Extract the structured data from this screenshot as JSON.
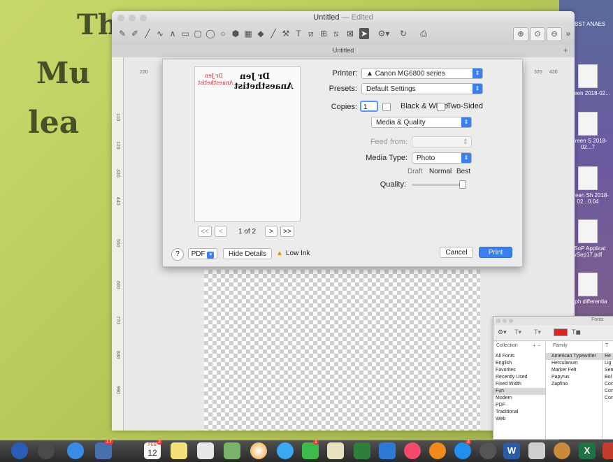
{
  "whiteboard": {
    "line1": "Th",
    "line2": "Mu",
    "line3": "lea"
  },
  "desktop": {
    "files": [
      {
        "label": "OBST ANAES"
      },
      {
        "label": "Screen 2018-02..."
      },
      {
        "label": "Screen S 2018-02...7"
      },
      {
        "label": "Screen Sh 2018-02...0.04"
      },
      {
        "label": "CSoP Applicat vSep17.pdf"
      },
      {
        "label": "pdph differentia"
      }
    ],
    "side_label_1": "n",
    "side_label_2": "m"
  },
  "window": {
    "title": "Untitled",
    "edited": "— Edited",
    "tab_title": "Untitled",
    "ruler_ticks": [
      "220",
      "110",
      "120",
      "330",
      "440",
      "550",
      "660",
      "770",
      "880",
      "990"
    ],
    "ruler_right_1": "320",
    "ruler_right_2": "430",
    "ruler_left_top": "220"
  },
  "print": {
    "printer_label": "Printer:",
    "printer_value": "▲ Canon MG6800 series",
    "presets_label": "Presets:",
    "presets_value": "Default Settings",
    "copies_label": "Copies:",
    "copies_value": "1",
    "bw_label": "Black & White",
    "twosided_label": "Two-Sided",
    "section_value": "Media & Quality",
    "feed_label": "Feed from:",
    "media_label": "Media Type:",
    "media_value": "Photo",
    "quality_label": "Quality:",
    "quality_draft": "Draft",
    "quality_normal": "Normal",
    "quality_best": "Best",
    "quality_level": 1.0,
    "page_indicator": "1 of 2",
    "preview_text_1": "Dr Jen",
    "preview_text_2": "Anaesthetist",
    "preview_small_1": "Dr Jen",
    "preview_small_2": "Anaesthetist",
    "help": "?",
    "pdf": "PDF",
    "hide_details": "Hide Details",
    "low_ink": "Low Ink",
    "cancel": "Cancel",
    "print": "Print",
    "nav_first": "<<",
    "nav_prev": "<",
    "nav_next": ">",
    "nav_last": ">>"
  },
  "fonts_panel": {
    "title": "Fonts",
    "collection_header": "Collection",
    "family_header": "Family",
    "typeface_header": "T",
    "collections": [
      "All Fonts",
      "English",
      "Favorites",
      "Recently Used",
      "Fixed Width",
      "Fun",
      "Modern",
      "PDF",
      "Traditional",
      "Web"
    ],
    "families": [
      "American Typewriter",
      "Herculanum",
      "Marker Felt",
      "Papyrus",
      "Zapfino"
    ],
    "typefaces": [
      "Re",
      "Lig",
      "Sem",
      "Bol",
      "Con",
      "Con",
      "Conc"
    ],
    "plus_minus": "+ −"
  },
  "dock": {
    "calendar_day": "12",
    "calendar_month": "FEB",
    "badge_1": "17",
    "badge_2": "2",
    "badge_3": "1",
    "badge_4": "3",
    "word_icon": "W",
    "excel_icon": "X"
  },
  "colors": {
    "accent": "#3a7ff0",
    "whiteboard": "#c3d364",
    "window_bg": "#e6e6e6"
  }
}
